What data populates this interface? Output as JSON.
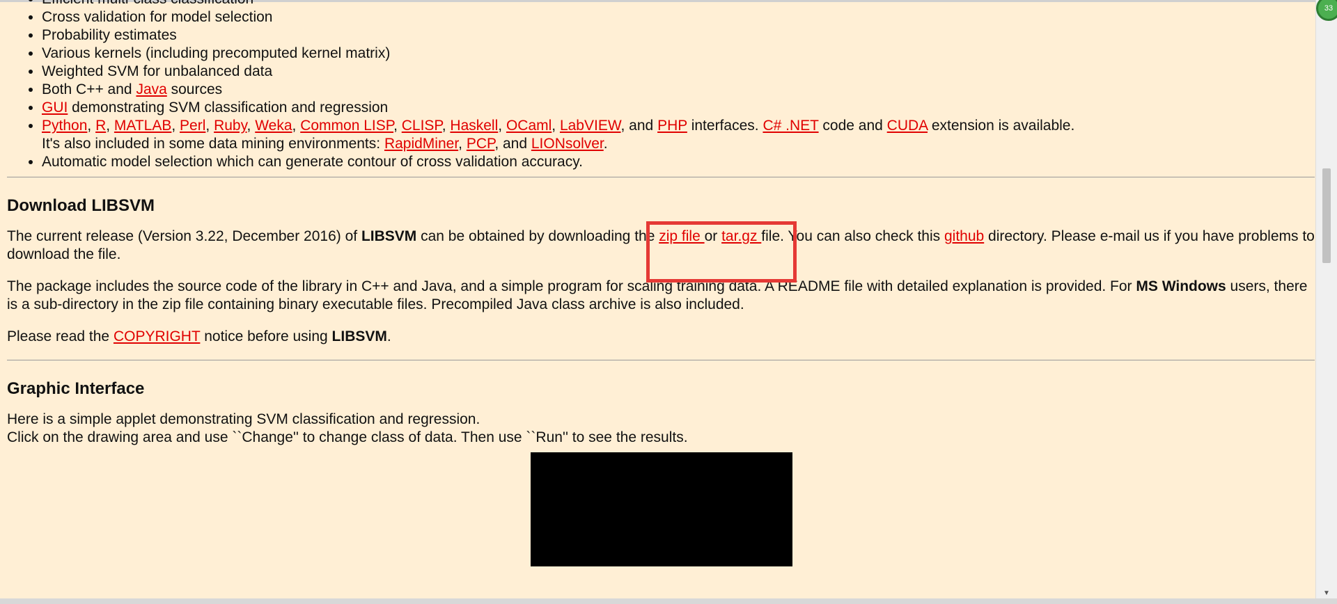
{
  "features": {
    "items": [
      "Efficient multi-class classification",
      "Cross validation for model selection",
      "Probability estimates",
      "Various kernels (including precomputed kernel matrix)",
      "Weighted SVM for unbalanced data"
    ],
    "item_cpp_java": {
      "before": "Both C++ and ",
      "link": "Java",
      "after": " sources"
    },
    "item_gui": {
      "link": "GUI",
      "after": " demonstrating SVM classification and regression"
    },
    "item_interfaces": {
      "links": [
        "Python",
        "R",
        "MATLAB",
        "Perl",
        "Ruby",
        "Weka",
        "Common LISP",
        "CLISP",
        "Haskell",
        "OCaml",
        "LabVIEW"
      ],
      "and_text": ", and ",
      "php": "PHP",
      "mid": " interfaces. ",
      "csharp": "C# .NET",
      "code_and": " code and ",
      "cuda": "CUDA",
      "available": " extension is available.",
      "line2_before": "It's also included in some data mining environments: ",
      "rapidminer": "RapidMiner",
      "pcp": "PCP",
      "and2": ", and ",
      "lionsolver": "LIONsolver",
      "end": "."
    },
    "last_item": "Automatic model selection which can generate contour of cross validation accuracy."
  },
  "download": {
    "heading": "Download LIBSVM",
    "p1": {
      "t1": "The current release (Version 3.22, December 2016) of ",
      "libsvm": "LIBSVM",
      "t2": " can be obtained by downloading the ",
      "zip": "zip file ",
      "or": " or ",
      "targz": "tar.gz ",
      "t3": "file. You can also check this ",
      "github": "github",
      "t4": " directory. Please e-mail us if you have problems to download the file."
    },
    "p2": {
      "t1": "The package includes the source code of the library in C++ and Java, and a simple program for scaling training data. A README file with detailed explanation is provided. For ",
      "mswin": "MS Windows",
      "t2": " users, there is a sub-directory in the zip file containing binary executable files. Precompiled Java class archive is also included."
    },
    "p3": {
      "t1": "Please read the ",
      "copyright": "COPYRIGHT",
      "t2": " notice before using ",
      "libsvm": "LIBSVM",
      "t3": "."
    }
  },
  "graphic": {
    "heading": "Graphic Interface",
    "line1": "Here is a simple applet demonstrating SVM classification and regression.",
    "line2": "Click on the drawing area and use ``Change'' to change class of data. Then use ``Run'' to see the results."
  },
  "browser": {
    "extension_badge": "33"
  },
  "colors": {
    "background": "#FFEFD5",
    "link": "#e00000",
    "highlight": "#e53935"
  }
}
